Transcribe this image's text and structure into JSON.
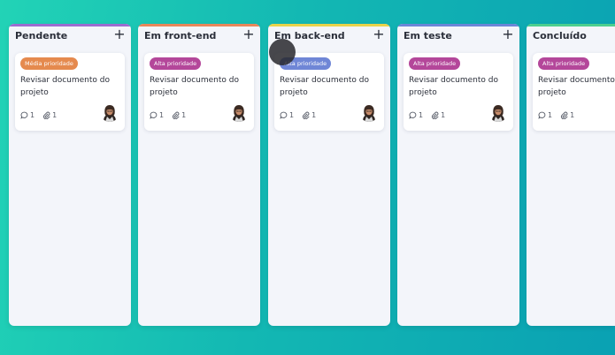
{
  "board": {
    "columns": [
      {
        "title": "Pendente",
        "add_symbol": "+",
        "accent": "#9b6cd1",
        "card": {
          "priority": "Média prioridade",
          "priority_color": "#e58a4e",
          "title": "Revisar documento do projeto",
          "comments": "1",
          "attachments": "1"
        }
      },
      {
        "title": "Em front-end",
        "add_symbol": "+",
        "accent": "#e9875a",
        "card": {
          "priority": "Alta prioridade",
          "priority_color": "#b4479a",
          "title": "Revisar documento do projeto",
          "comments": "1",
          "attachments": "1"
        }
      },
      {
        "title": "Em back-end",
        "add_symbol": "+",
        "accent": "#e8d34a",
        "card": {
          "priority": "Alta prioridade",
          "priority_color": "#6f86d6",
          "title": "Revisar documento do projeto",
          "comments": "1",
          "attachments": "1"
        }
      },
      {
        "title": "Em teste",
        "add_symbol": "+",
        "accent": "#6b86d8",
        "card": {
          "priority": "Alta prioridade",
          "priority_color": "#b4479a",
          "title": "Revisar documento do projeto",
          "comments": "1",
          "attachments": "1"
        }
      },
      {
        "title": "Concluído",
        "add_symbol": "+",
        "accent": "#4ccf8f",
        "card": {
          "priority": "Alta prioridade",
          "priority_color": "#b4479a",
          "title": "Revisar documento do projeto",
          "comments": "1",
          "attachments": "1"
        }
      }
    ]
  }
}
